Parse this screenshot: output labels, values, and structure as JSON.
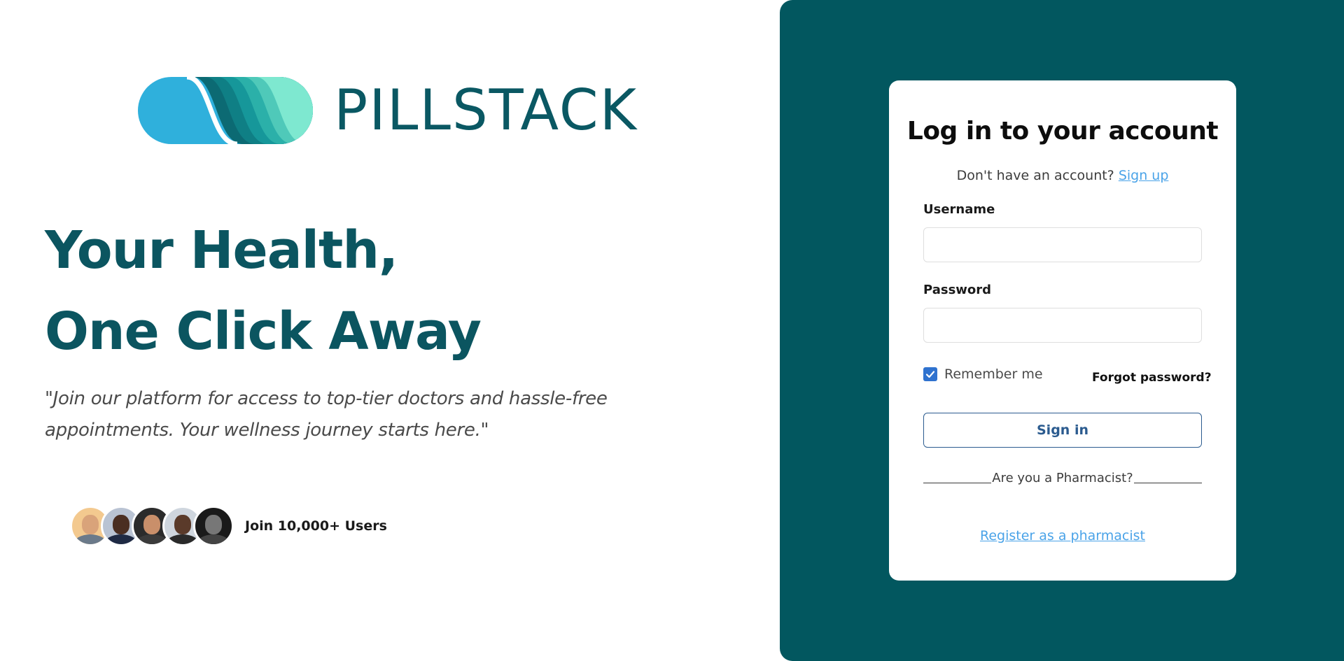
{
  "brand": {
    "name": "PILLSTACK",
    "colors": {
      "primary": "#02575f",
      "logo_light": "#2fb0dc",
      "logo_teal": "#0f8c8c",
      "logo_mint": "#7ee8d0"
    }
  },
  "hero": {
    "headline_line1": "Your Health,",
    "headline_line2": "One Click Away",
    "tagline": "\"Join our platform for access to top-tier doctors and hassle-free appointments. Your wellness journey starts here.\"",
    "social_proof": "Join 10,000+ Users",
    "avatars": [
      "avatar-icon",
      "avatar-icon",
      "avatar-icon",
      "avatar-icon",
      "avatar-icon"
    ]
  },
  "login": {
    "title": "Log in to your account",
    "signup_prompt": "Don't have an account?",
    "signup_link": "Sign up",
    "username_label": "Username",
    "username_value": "",
    "password_label": "Password",
    "password_value": "",
    "remember_label": "Remember me",
    "remember_checked": true,
    "forgot_link": "Forgot password?",
    "signin_button": "Sign in",
    "divider_text": "Are you a Pharmacist?",
    "register_link": "Register as a pharmacist"
  }
}
